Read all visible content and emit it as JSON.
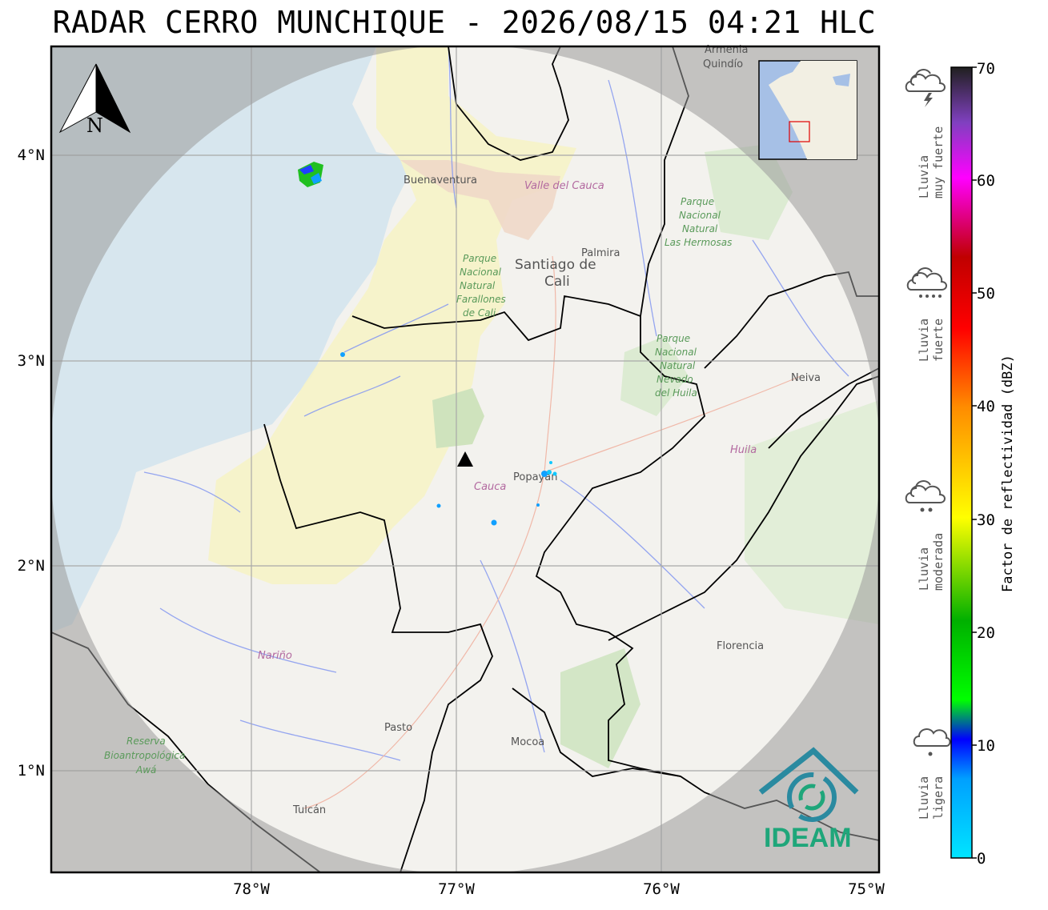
{
  "title": "RADAR CERRO MUNCHIQUE - 2026/08/15 04:21 HLC",
  "axes": {
    "x_ticks": [
      "78°W",
      "77°W",
      "76°W",
      "75°W"
    ],
    "y_ticks": [
      "4°N",
      "3°N",
      "2°N",
      "1°N"
    ]
  },
  "north_arrow": "N",
  "places": {
    "buenaventura": "Buenaventura",
    "valle": "Valle del Cauca",
    "palmira": "Palmira",
    "cali_1": "Santiago de",
    "cali_2": "Cali",
    "farallones": [
      "Parque",
      "Nacional",
      "Natural",
      "Farallones",
      "de Cali"
    ],
    "hermosas": [
      "Parque",
      "Nacional",
      "Natural",
      "Las Hermosas"
    ],
    "huila_park": [
      "Parque",
      "Nacional",
      "Natural",
      "Nevado",
      "del Huila"
    ],
    "neiva": "Neiva",
    "huila": "Huila",
    "popayan": "Popayán",
    "cauca": "Cauca",
    "narino": "Nariño",
    "florencia": "Florencia",
    "pasto": "Pasto",
    "mocoa": "Mocoa",
    "tulcan": "Tulcán",
    "reserva": [
      "Reserva",
      "Bioantropológica",
      "Awá"
    ],
    "armenia": "Armenia",
    "quindio": "Quindío"
  },
  "legend": {
    "categories": [
      {
        "line1": "Lluvia",
        "line2": "muy fuerte",
        "icon": "thunderstorm-icon"
      },
      {
        "line1": "Lluvia",
        "line2": "fuerte",
        "icon": "heavy-rain-icon"
      },
      {
        "line1": "Lluvia",
        "line2": "moderada",
        "icon": "moderate-rain-icon"
      },
      {
        "line1": "Lluvia",
        "line2": "ligera",
        "icon": "light-rain-icon"
      }
    ],
    "colorbar_ticks": [
      "70",
      "60",
      "50",
      "40",
      "30",
      "20",
      "10",
      "0"
    ],
    "colorbar_label": "Factor de reflectividad (dBZ)",
    "range_dbz": [
      0,
      70
    ]
  },
  "logo_text": "IDEAM",
  "colors": {
    "ocean": "#cfe0ea",
    "land": "#f7f6f2",
    "outside_range": "#b9b9b9",
    "radar_site": "#000000",
    "logo": "#1fa67a"
  }
}
